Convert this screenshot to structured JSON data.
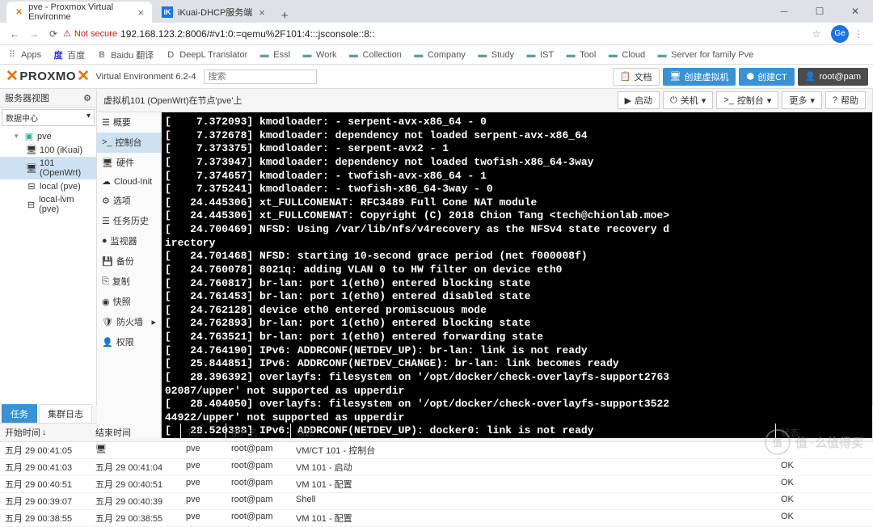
{
  "browser": {
    "tabs": [
      {
        "favicon": "pve",
        "title": "pve - Proxmox Virtual Environme",
        "active": true
      },
      {
        "favicon": "ik",
        "title": "iKuai-DHCP服务端",
        "active": false
      }
    ],
    "security_label": "Not secure",
    "url": "192.168.123.2:8006/#v1:0:=qemu%2F101:4:::jsconsole::8::",
    "avatar": "Ge"
  },
  "bookmarks": [
    {
      "type": "apps",
      "label": "Apps"
    },
    {
      "type": "site",
      "label": "百度",
      "icon": "度"
    },
    {
      "type": "site",
      "label": "Baidu 翻译",
      "icon": "B"
    },
    {
      "type": "site",
      "label": "DeepL Translator",
      "icon": "D"
    },
    {
      "type": "folder",
      "label": "Essl"
    },
    {
      "type": "folder",
      "label": "Work"
    },
    {
      "type": "folder",
      "label": "Collection"
    },
    {
      "type": "folder",
      "label": "Company"
    },
    {
      "type": "folder",
      "label": "Study"
    },
    {
      "type": "folder",
      "label": "IST"
    },
    {
      "type": "folder",
      "label": "Tool"
    },
    {
      "type": "folder",
      "label": "Cloud"
    },
    {
      "type": "folder",
      "label": "Server for family Pve"
    }
  ],
  "pve": {
    "logo_main": "PROXMO",
    "virtual_env": "Virtual Environment 6.2-4",
    "search_placeholder": "搜索",
    "header_buttons": {
      "docs": "文档",
      "create_vm": "创建虚拟机",
      "create_ct": "创建CT",
      "user": "root@pam"
    }
  },
  "left_panel": {
    "title": "服务器视图",
    "dropdown": "数据中心",
    "tree": [
      {
        "level": 2,
        "icon": "server",
        "label": "pve"
      },
      {
        "level": 3,
        "icon": "vm",
        "label": "100 (iKuai)"
      },
      {
        "level": 3,
        "icon": "vm",
        "label": "101 (OpenWrt)",
        "selected": true
      },
      {
        "level": 3,
        "icon": "disk",
        "label": "local (pve)"
      },
      {
        "level": 3,
        "icon": "disk",
        "label": "local-lvm (pve)"
      }
    ]
  },
  "content": {
    "title": "虚拟机101 (OpenWrt)在节点'pve'上",
    "actions": {
      "start": "启动",
      "shutdown": "关机",
      "console": "控制台",
      "more": "更多",
      "help": "帮助"
    },
    "subnav": [
      {
        "icon": "list",
        "label": "概要"
      },
      {
        "icon": "terminal",
        "label": "控制台",
        "active": true
      },
      {
        "icon": "desktop",
        "label": "硬件"
      },
      {
        "icon": "cloud",
        "label": "Cloud-Init"
      },
      {
        "icon": "cog",
        "label": "选项"
      },
      {
        "icon": "clock",
        "label": "任务历史"
      },
      {
        "icon": "eye",
        "label": "监视器"
      },
      {
        "icon": "save",
        "label": "备份"
      },
      {
        "icon": "copy",
        "label": "复制"
      },
      {
        "icon": "camera",
        "label": "快照"
      },
      {
        "icon": "shield",
        "label": "防火墙"
      },
      {
        "icon": "user",
        "label": "权限"
      }
    ]
  },
  "console_lines": [
    "[    7.372093] kmodloader: - serpent-avx-x86_64 - 0",
    "[    7.372678] kmodloader: dependency not loaded serpent-avx-x86_64",
    "[    7.373375] kmodloader: - serpent-avx2 - 1",
    "[    7.373947] kmodloader: dependency not loaded twofish-x86_64-3way",
    "[    7.374657] kmodloader: - twofish-avx-x86_64 - 1",
    "[    7.375241] kmodloader: - twofish-x86_64-3way - 0",
    "[   24.445306] xt_FULLCONENAT: RFC3489 Full Cone NAT module",
    "[   24.445306] xt_FULLCONENAT: Copyright (C) 2018 Chion Tang <tech@chionlab.moe>",
    "[   24.700469] NFSD: Using /var/lib/nfs/v4recovery as the NFSv4 state recovery d",
    "irectory",
    "[   24.701468] NFSD: starting 10-second grace period (net f000008f)",
    "[   24.760078] 8021q: adding VLAN 0 to HW filter on device eth0",
    "[   24.760817] br-lan: port 1(eth0) entered blocking state",
    "[   24.761453] br-lan: port 1(eth0) entered disabled state",
    "[   24.762128] device eth0 entered promiscuous mode",
    "[   24.762893] br-lan: port 1(eth0) entered blocking state",
    "[   24.763521] br-lan: port 1(eth0) entered forwarding state",
    "[   24.764190] IPv6: ADDRCONF(NETDEV_UP): br-lan: link is not ready",
    "[   25.844851] IPv6: ADDRCONF(NETDEV_CHANGE): br-lan: link becomes ready",
    "[   28.396392] overlayfs: filesystem on '/opt/docker/check-overlayfs-support2763",
    "02087/upper' not supported as upperdir",
    "[   28.404050] overlayfs: filesystem on '/opt/docker/check-overlayfs-support3522",
    "44922/upper' not supported as upperdir",
    "[   28.520388] IPv6: ADDRCONF(NETDEV_UP): docker0: link is not ready"
  ],
  "bottom": {
    "tabs": {
      "tasks": "任务",
      "cluster_log": "集群日志"
    },
    "columns": {
      "start": "开始时间",
      "end": "结束时间",
      "node": "节点",
      "user": "用户名",
      "desc": "描述",
      "status": "状态"
    },
    "rows": [
      {
        "start": "五月 29 00:41:05",
        "end_icon": true,
        "end": "",
        "node": "pve",
        "user": "root@pam",
        "desc": "VM/CT 101 - 控制台",
        "status": ""
      },
      {
        "start": "五月 29 00:41:03",
        "end": "五月 29 00:41:04",
        "node": "pve",
        "user": "root@pam",
        "desc": "VM 101 - 启动",
        "status": "OK"
      },
      {
        "start": "五月 29 00:40:51",
        "end": "五月 29 00:40:51",
        "node": "pve",
        "user": "root@pam",
        "desc": "VM 101 - 配置",
        "status": "OK"
      },
      {
        "start": "五月 29 00:39:07",
        "end": "五月 29 00:40:39",
        "node": "pve",
        "user": "root@pam",
        "desc": "Shell",
        "status": "OK"
      },
      {
        "start": "五月 29 00:38:55",
        "end": "五月 29 00:38:55",
        "node": "pve",
        "user": "root@pam",
        "desc": "VM 101 - 配置",
        "status": "OK"
      }
    ]
  },
  "watermark": "值 ·么值得买"
}
